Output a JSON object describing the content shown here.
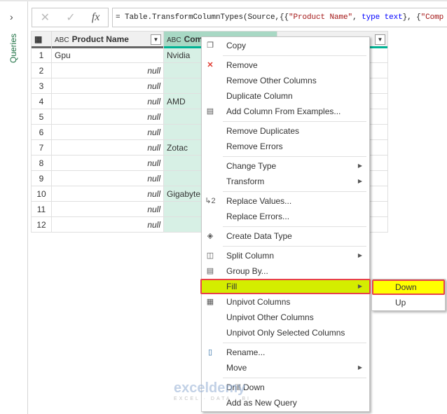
{
  "sidebar": {
    "expand_icon": "chevron-right-icon",
    "label": "Queries"
  },
  "formula_bar": {
    "cancel": "✕",
    "confirm": "✓",
    "fx": "fx",
    "prefix": "= Table.TransformColumnTypes(Source,{{",
    "s1": "\"Product Name\"",
    "mid": ", ",
    "k1": "type text",
    "tail": "}, {",
    "s2": "\"Comp"
  },
  "table": {
    "headers": [
      "Product Name",
      "Comp",
      ""
    ],
    "type_badge": "ABC",
    "rows": [
      [
        "1",
        "Gpu",
        "Nvidia"
      ],
      [
        "2",
        "null",
        ""
      ],
      [
        "3",
        "null",
        ""
      ],
      [
        "4",
        "null",
        "AMD"
      ],
      [
        "5",
        "null",
        ""
      ],
      [
        "6",
        "null",
        ""
      ],
      [
        "7",
        "null",
        "Zotac"
      ],
      [
        "8",
        "null",
        ""
      ],
      [
        "9",
        "null",
        ""
      ],
      [
        "10",
        "null",
        "Gigabyte"
      ],
      [
        "11",
        "null",
        ""
      ],
      [
        "12",
        "null",
        ""
      ]
    ]
  },
  "context_menu": {
    "items": {
      "copy": "Copy",
      "remove": "Remove",
      "remove_other": "Remove Other Columns",
      "duplicate": "Duplicate Column",
      "add_from_examples": "Add Column From Examples...",
      "remove_duplicates": "Remove Duplicates",
      "remove_errors": "Remove Errors",
      "change_type": "Change Type",
      "transform": "Transform",
      "replace_values": "Replace Values...",
      "replace_errors": "Replace Errors...",
      "create_data_type": "Create Data Type",
      "split_column": "Split Column",
      "group_by": "Group By...",
      "fill": "Fill",
      "unpivot": "Unpivot Columns",
      "unpivot_other": "Unpivot Other Columns",
      "unpivot_selected": "Unpivot Only Selected Columns",
      "rename": "Rename...",
      "move": "Move",
      "drill_down": "Drill Down",
      "add_new_query": "Add as New Query"
    }
  },
  "fill_submenu": {
    "down": "Down",
    "up": "Up"
  },
  "watermark": {
    "brand": "exceldemy",
    "tagline": "EXCEL · DATA · BI"
  },
  "colors": {
    "highlight": "#d4ed00",
    "submenu_highlight": "#ffff00",
    "outline": "#e8414a",
    "accent": "#00b294"
  }
}
